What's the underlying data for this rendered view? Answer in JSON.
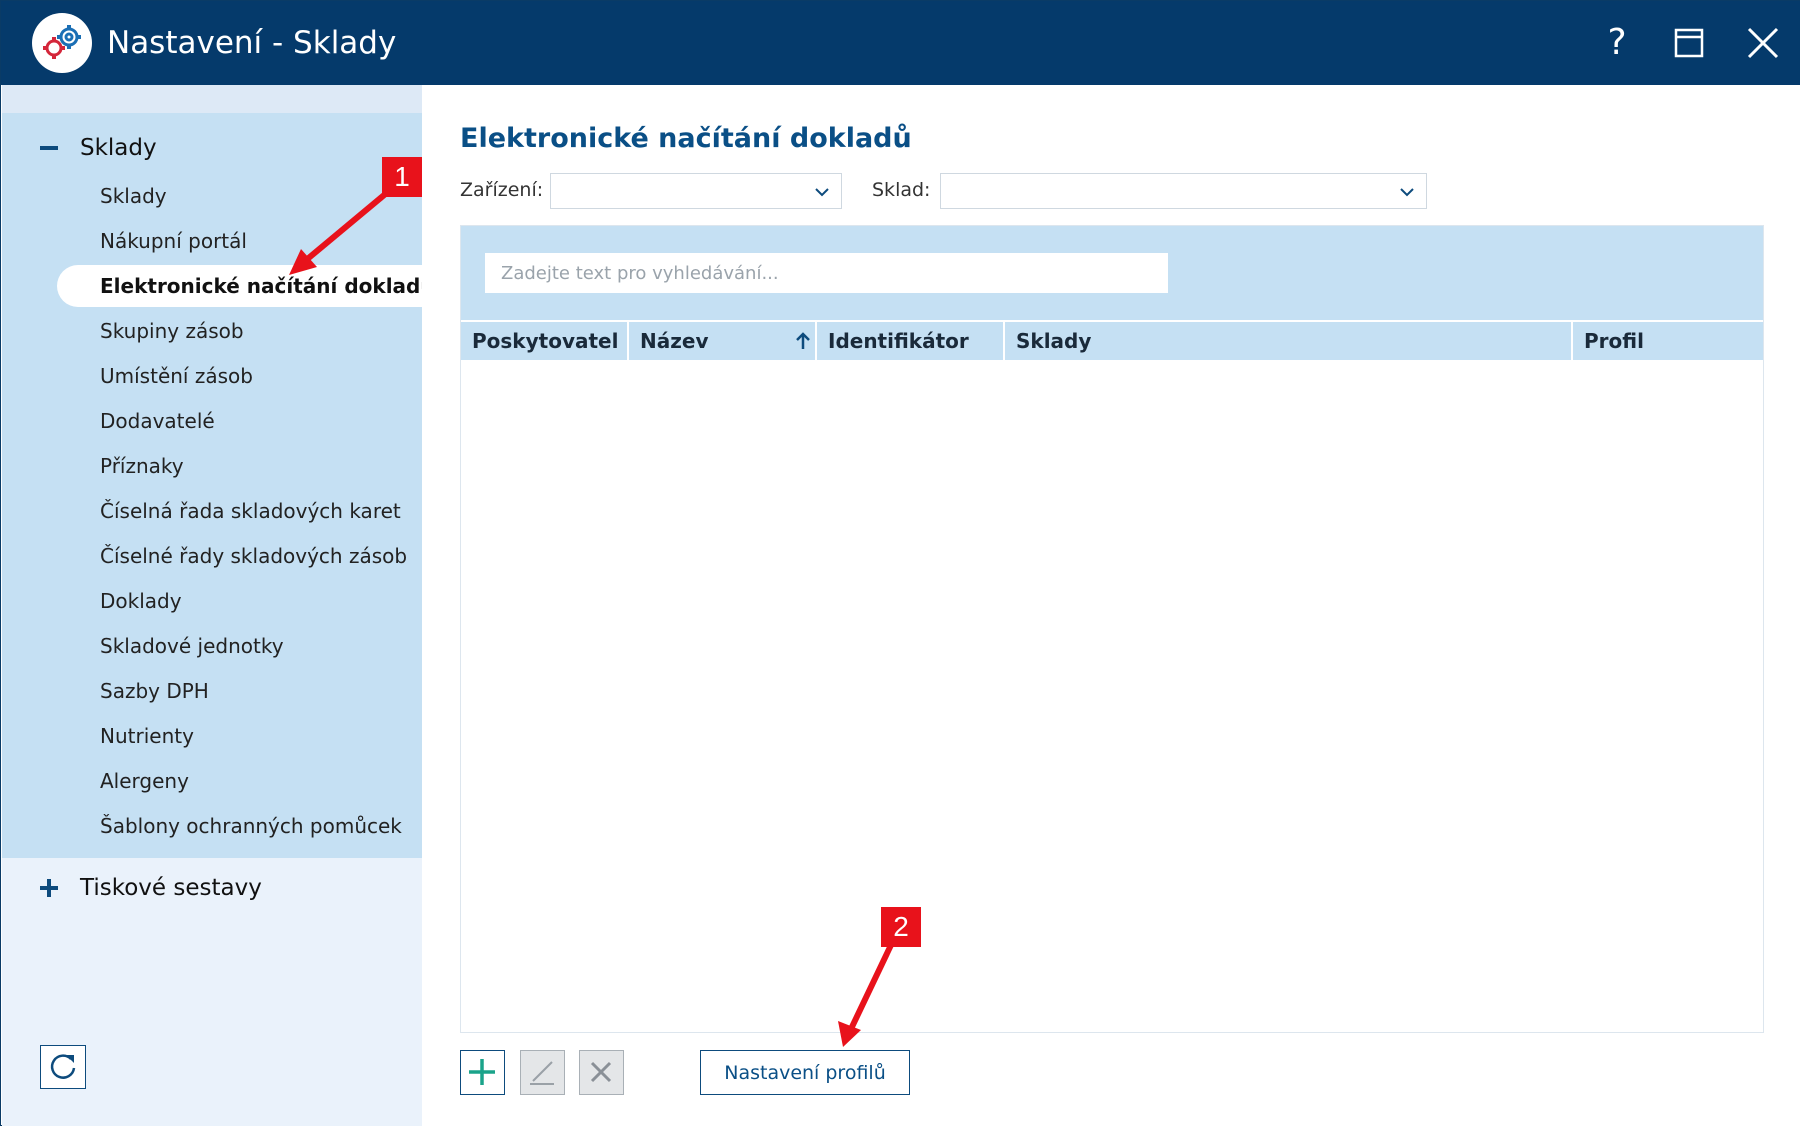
{
  "window": {
    "title": "Nastavení - Sklady",
    "help_glyph": "?"
  },
  "sidebar": {
    "groups": [
      {
        "label": "Sklady",
        "expanded": true,
        "items": [
          {
            "label": "Sklady",
            "active": false
          },
          {
            "label": "Nákupní portál",
            "active": false
          },
          {
            "label": "Elektronické načítání dokladů",
            "active": true
          },
          {
            "label": "Skupiny zásob",
            "active": false
          },
          {
            "label": "Umístění zásob",
            "active": false
          },
          {
            "label": "Dodavatelé",
            "active": false
          },
          {
            "label": "Příznaky",
            "active": false
          },
          {
            "label": "Číselná řada skladových karet",
            "active": false
          },
          {
            "label": "Číselné řady skladových zásob",
            "active": false
          },
          {
            "label": "Doklady",
            "active": false
          },
          {
            "label": "Skladové jednotky",
            "active": false
          },
          {
            "label": "Sazby DPH",
            "active": false
          },
          {
            "label": "Nutrienty",
            "active": false
          },
          {
            "label": "Alergeny",
            "active": false
          },
          {
            "label": "Šablony ochranných pomůcek",
            "active": false
          }
        ]
      },
      {
        "label": "Tiskové sestavy",
        "expanded": false,
        "items": []
      }
    ]
  },
  "main": {
    "title": "Elektronické načítání dokladů",
    "filters": {
      "device_label": "Zařízení:",
      "device_value": "",
      "warehouse_label": "Sklad:",
      "warehouse_value": ""
    },
    "search": {
      "placeholder": "Zadejte text pro vyhledávání...",
      "value": ""
    },
    "columns": [
      {
        "label": "Poskytovatel",
        "sorted": false
      },
      {
        "label": "Název",
        "sorted": "asc"
      },
      {
        "label": "Identifikátor",
        "sorted": false
      },
      {
        "label": "Sklady",
        "sorted": false
      },
      {
        "label": "Profil",
        "sorted": false
      }
    ],
    "rows": [],
    "buttons": {
      "profile_settings": "Nastavení profilů"
    }
  },
  "annotations": {
    "badge_1": "1",
    "badge_2": "2",
    "color": "#e8121b"
  },
  "colors": {
    "titlebar": "#053a6b",
    "accent": "#0a4f86",
    "panel": "#c5e0f3",
    "add_icon": "#1aa38a"
  }
}
